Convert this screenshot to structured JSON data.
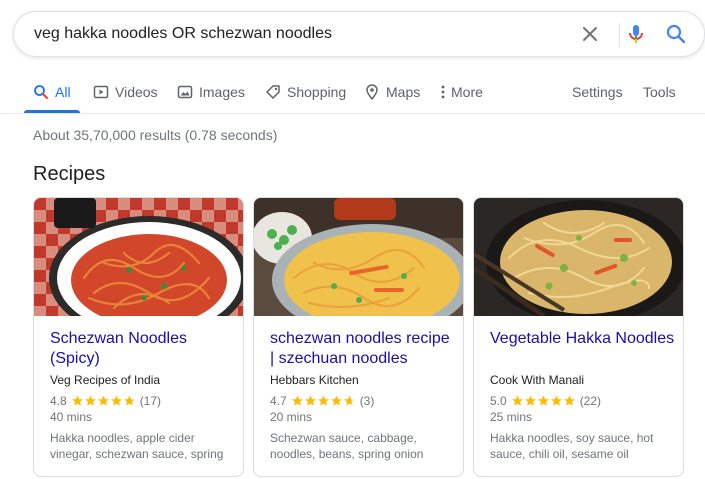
{
  "search": {
    "query": "veg hakka noodles OR schezwan noodles",
    "clear_icon": "close-icon",
    "mic_icon": "microphone-icon",
    "search_icon": "magnifier-icon"
  },
  "tabs": [
    {
      "label": "All",
      "icon": "search-icon",
      "active": true
    },
    {
      "label": "Videos",
      "icon": "play-icon"
    },
    {
      "label": "Images",
      "icon": "image-icon"
    },
    {
      "label": "Shopping",
      "icon": "tag-icon"
    },
    {
      "label": "Maps",
      "icon": "pin-icon"
    },
    {
      "label": "More",
      "icon": "more-vert-icon"
    },
    {
      "label": "Settings"
    },
    {
      "label": "Tools"
    }
  ],
  "result_stats": "About 35,70,000 results (0.78 seconds)",
  "recipes": {
    "title": "Recipes",
    "cards": [
      {
        "title": "Schezwan Noodles (Spicy)",
        "source": "Veg Recipes of India",
        "rating": "4.8",
        "rating_value": 4.8,
        "reviews": "(17)",
        "time": "40 mins",
        "ingredients": "Hakka noodles, apple cider vinegar, schezwan sauce, spring"
      },
      {
        "title": "schezwan noodles recipe | szechuan noodles",
        "source": "Hebbars Kitchen",
        "rating": "4.7",
        "rating_value": 4.7,
        "reviews": "(3)",
        "time": "20 mins",
        "ingredients": "Schezwan sauce, cabbage, noodles, beans, spring onion"
      },
      {
        "title": "Vegetable Hakka Noodles",
        "source": "Cook With Manali",
        "rating": "5.0",
        "rating_value": 5.0,
        "reviews": "(22)",
        "time": "25 mins",
        "ingredients": "Hakka noodles, soy sauce, hot sauce, chili oil, sesame oil"
      }
    ]
  },
  "colors": {
    "link": "#1a0dab",
    "accent": "#1a73e8",
    "star": "#fbbc04",
    "muted": "#70757a"
  }
}
